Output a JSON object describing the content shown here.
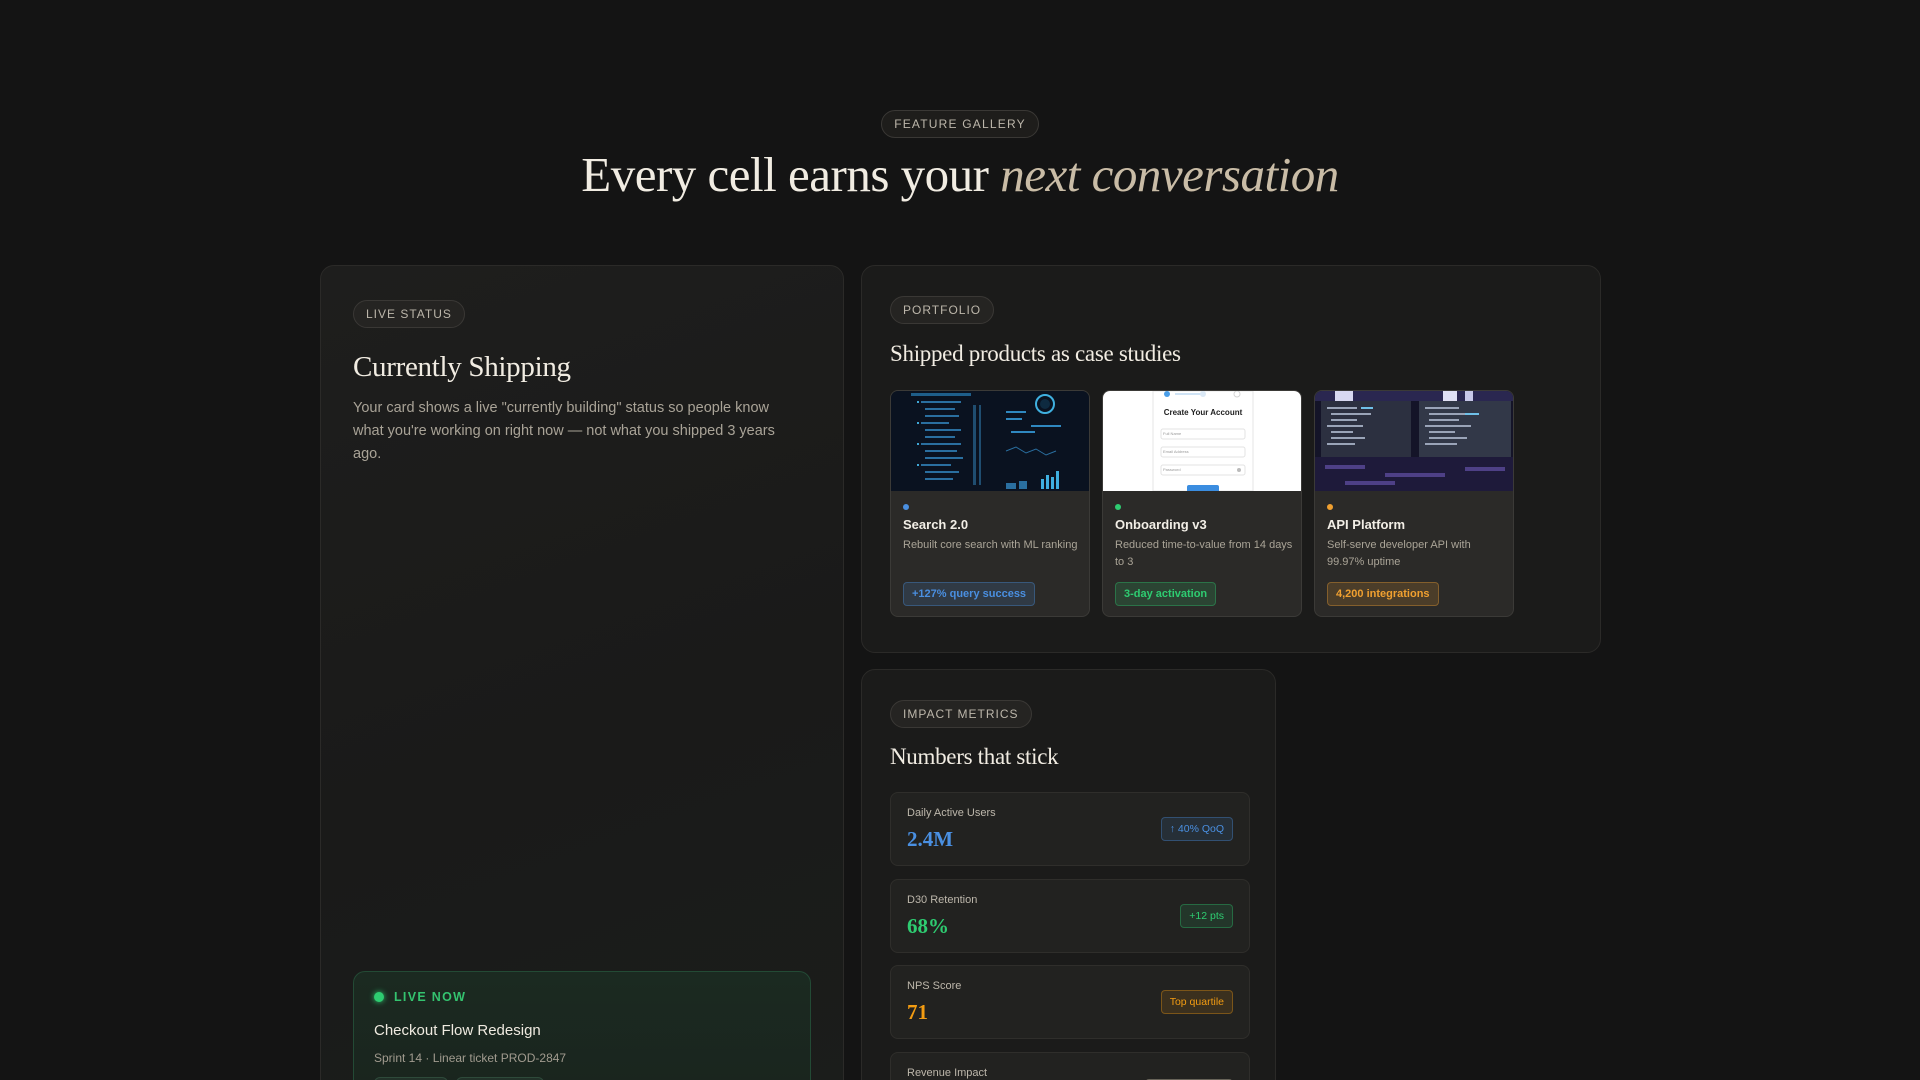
{
  "header": {
    "eyebrow": "FEATURE GALLERY",
    "headline_plain": "Every cell earns your ",
    "headline_italic": "next conversation"
  },
  "live_status": {
    "pill": "LIVE STATUS",
    "title": "Currently Shipping",
    "description": "Your card shows a live \"currently building\" status so people know what you're working on right now — not what you shipped 3 years ago.",
    "live": {
      "label": "LIVE NOW",
      "project": "Checkout Flow Redesign",
      "meta": "Sprint 14 · Linear ticket PROD-2847"
    }
  },
  "portfolio": {
    "pill": "PORTFOLIO",
    "title": "Shipped products as case studies",
    "projects": [
      {
        "name": "Search 2.0",
        "description": "Rebuilt core search with ML ranking",
        "badge": "+127% query success",
        "accent": "#4a8fe0",
        "thumb": "dashboard-screenshot"
      },
      {
        "name": "Onboarding v3",
        "description": "Reduced time-to-value from 14 days to 3",
        "badge": "3-day activation",
        "accent": "#2ecc71",
        "thumb": "signup-form-screenshot",
        "thumb_text": {
          "heading": "Create Your Account",
          "fields": [
            "Full Name",
            "Email Address",
            "Password"
          ]
        }
      },
      {
        "name": "API Platform",
        "description": "Self-serve developer API with 99.97% uptime",
        "badge": "4,200 integrations",
        "accent": "#f0a030",
        "thumb": "code-editor-screenshot"
      }
    ]
  },
  "metrics": {
    "pill": "IMPACT METRICS",
    "title": "Numbers that stick",
    "items": [
      {
        "label": "Daily Active Users",
        "value": "2.4M",
        "delta": "↑ 40% QoQ",
        "color": "#4a90e2"
      },
      {
        "label": "D30 Retention",
        "value": "68%",
        "delta": "+12 pts",
        "color": "#2ecc71"
      },
      {
        "label": "NPS Score",
        "value": "71",
        "delta": "Top quartile",
        "color": "#f39c12"
      },
      {
        "label": "Revenue Impact",
        "value": "",
        "delta": "",
        "color": "#c9bca6"
      }
    ]
  }
}
